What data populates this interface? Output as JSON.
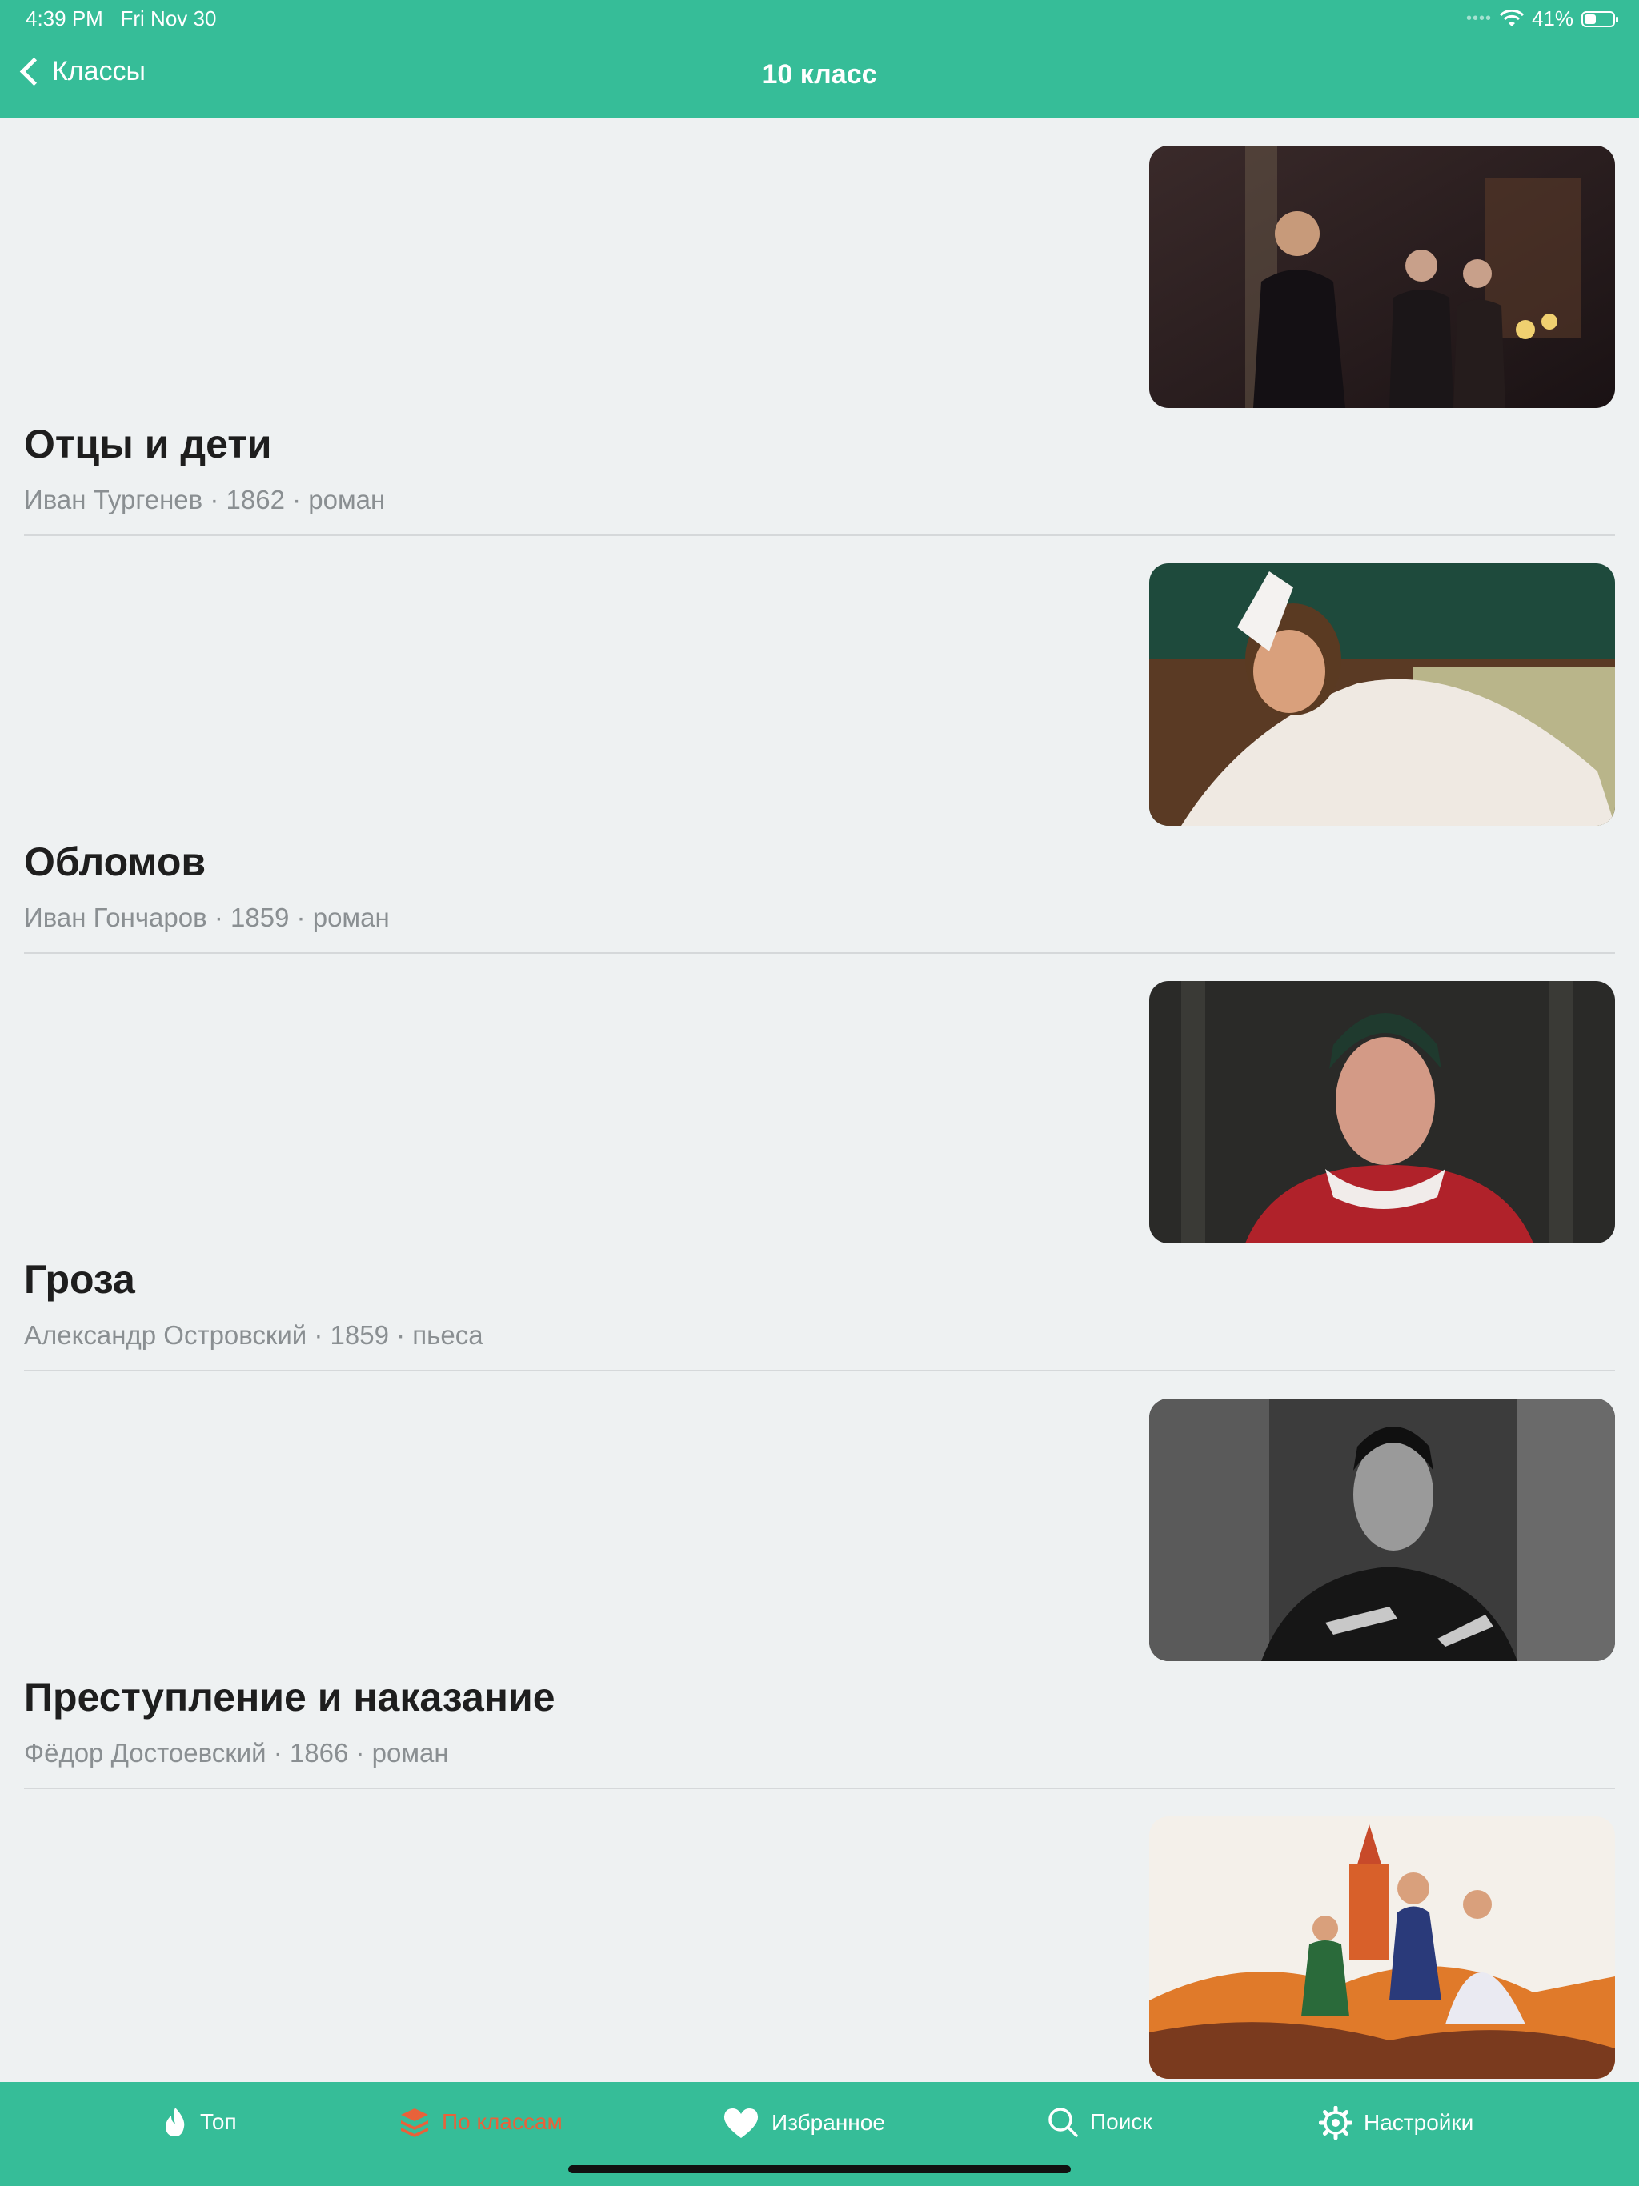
{
  "status": {
    "time": "4:39 PM",
    "date": "Fri Nov 30",
    "battery": "41%",
    "battery_level": 0.41
  },
  "nav": {
    "back_label": "Классы",
    "title": "10 класс"
  },
  "items": [
    {
      "title": "Отцы и дети",
      "meta": "Иван Тургенев · 1862 · роман"
    },
    {
      "title": "Обломов",
      "meta": "Иван Гончаров · 1859 · роман"
    },
    {
      "title": "Гроза",
      "meta": "Александр Островский · 1859 · пьеса"
    },
    {
      "title": "Преступление и наказание",
      "meta": "Фёдор Достоевский · 1866 · роман"
    },
    {
      "title": "",
      "meta": ""
    }
  ],
  "tabs": [
    {
      "label": "Топ",
      "icon": "flame-icon"
    },
    {
      "label": "По классам",
      "icon": "layers-icon",
      "active": true
    },
    {
      "label": "Избранное",
      "icon": "heart-icon"
    },
    {
      "label": "Поиск",
      "icon": "search-icon"
    },
    {
      "label": "Настройки",
      "icon": "gear-icon"
    }
  ],
  "colors": {
    "accent": "#36bd98",
    "active_tab": "#e8623a",
    "background": "#eef1f2"
  }
}
